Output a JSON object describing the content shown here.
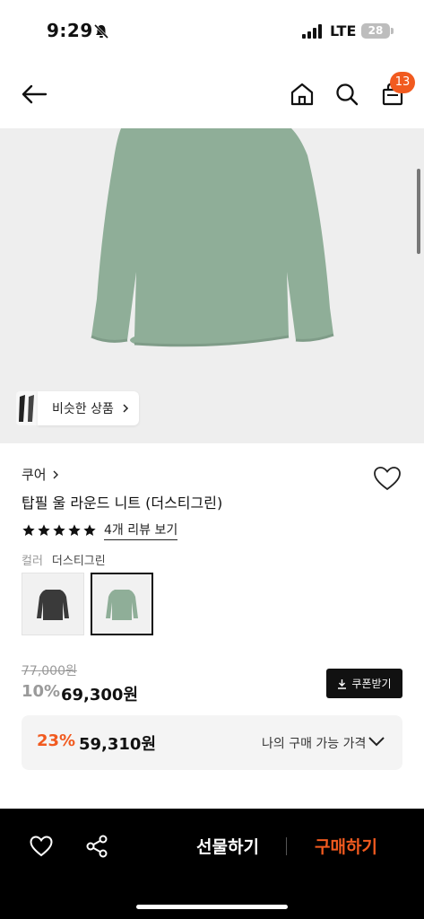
{
  "status_bar": {
    "time": "9:29",
    "network": "LTE",
    "battery": "28"
  },
  "nav": {
    "cart_count": "13",
    "icons": [
      "back-arrow-icon",
      "home-icon",
      "search-icon",
      "shopping-bag-icon"
    ]
  },
  "gallery": {
    "similar_label": "비슷한 상품",
    "product_color": "#8fae98"
  },
  "product": {
    "brand": "쿠어",
    "name": "탑필 울 라운드 니트 (더스티그린)",
    "rating": 5,
    "review_link": "4개 리뷰 보기",
    "color_label": "컬러",
    "color_value": "더스티그린",
    "swatches": [
      {
        "color": "#3a3a3a",
        "selected": false
      },
      {
        "color": "#8fae98",
        "selected": true
      }
    ]
  },
  "price": {
    "original": "77,000원",
    "discount_rate": "10%",
    "sale": "69,300원",
    "coupon_label": "쿠폰받기"
  },
  "my_price": {
    "rate": "23%",
    "price": "59,310원",
    "label": "나의 구매 가능 가격"
  },
  "bottom_bar": {
    "gift_label": "선물하기",
    "buy_label": "구매하기"
  },
  "colors": {
    "accent": "#f15a1f",
    "dark": "#111111"
  }
}
